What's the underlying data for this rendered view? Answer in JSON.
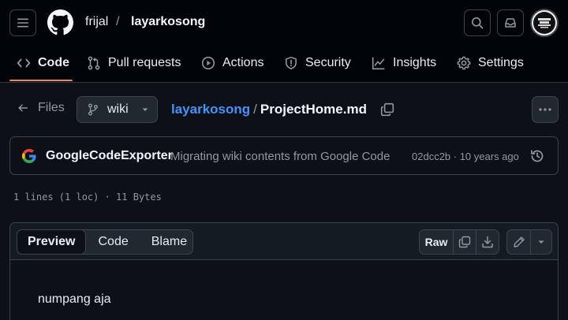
{
  "header": {
    "owner": "frijal",
    "separator": "/",
    "repo": "layarkosong"
  },
  "tabs": [
    {
      "label": "Code",
      "icon": "code-icon",
      "active": true
    },
    {
      "label": "Pull requests",
      "icon": "git-pull-request-icon"
    },
    {
      "label": "Actions",
      "icon": "play-icon"
    },
    {
      "label": "Security",
      "icon": "shield-icon"
    },
    {
      "label": "Insights",
      "icon": "graph-icon"
    },
    {
      "label": "Settings",
      "icon": "gear-icon"
    }
  ],
  "file_nav": {
    "files_label": "Files",
    "branch": "wiki",
    "path_repo": "layarkosong",
    "path_sep": "/",
    "path_file": "ProjectHome.md"
  },
  "commit": {
    "author": "GoogleCodeExporter",
    "message": "Migrating wiki contents from Google Code",
    "meta": "02dcc2b · 10 years ago"
  },
  "file_stats": "1 lines (1 loc) · 11 Bytes",
  "file_view": {
    "tabs": [
      "Preview",
      "Code",
      "Blame"
    ],
    "raw_label": "Raw",
    "content": "numpang aja"
  },
  "colors": {
    "accent_link": "#4493f8",
    "tab_underline": "#f78166",
    "background": "#0d1117"
  }
}
